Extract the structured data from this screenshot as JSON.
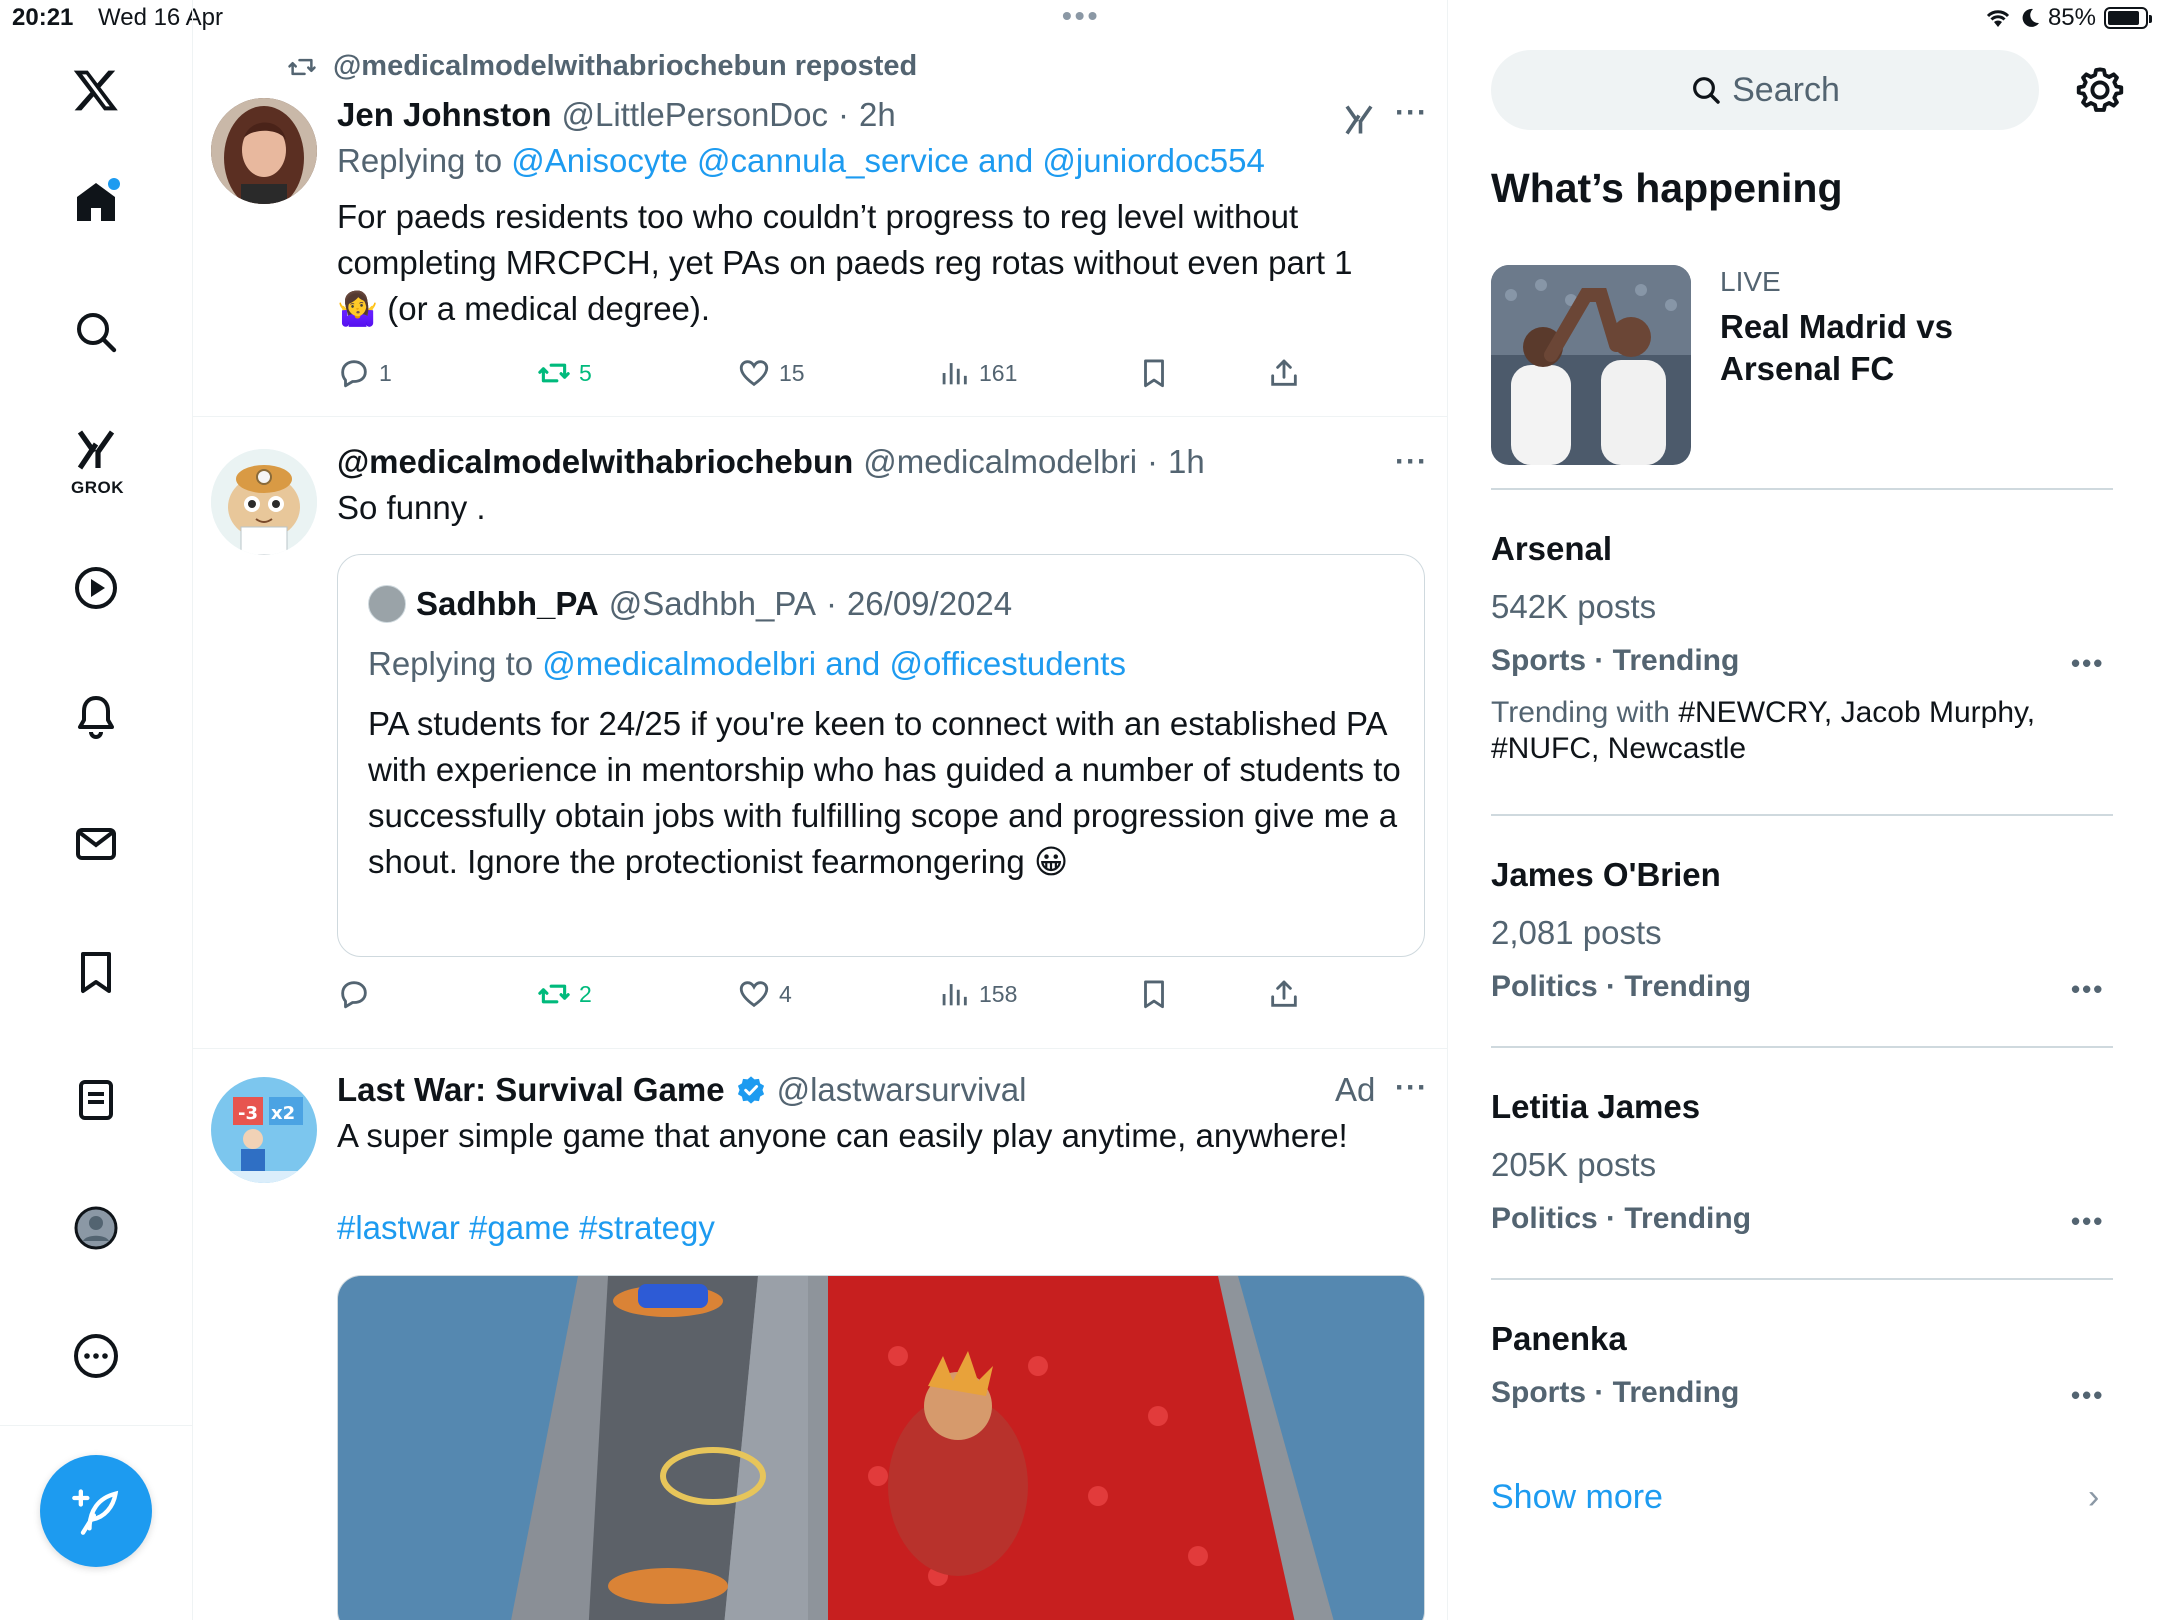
{
  "status_bar": {
    "time": "20:21",
    "date": "Wed 16 Apr",
    "battery_percent": "85%",
    "battery_level": 0.85
  },
  "nav": {
    "items": [
      {
        "name": "x-logo-icon"
      },
      {
        "name": "home-icon"
      },
      {
        "name": "search-icon"
      },
      {
        "name": "grok-icon",
        "label": "GROK"
      },
      {
        "name": "video-icon"
      },
      {
        "name": "notifications-icon"
      },
      {
        "name": "messages-icon"
      },
      {
        "name": "bookmarks-icon"
      },
      {
        "name": "lists-icon"
      },
      {
        "name": "profile-icon"
      },
      {
        "name": "more-icon"
      }
    ],
    "compose_icon": "compose-icon"
  },
  "tweets": [
    {
      "repost_label": "@medicalmodelwithabriochebun reposted",
      "name": "Jen Johnston",
      "handle": "@LittlePersonDoc",
      "time": "2h",
      "replying_prefix": "Replying to",
      "replying_to": "@Anisocyte @cannula_service and @juniordoc554",
      "text": "For paeds residents too who couldn’t progress to reg level without completing MRCPCH, yet PAs on paeds reg rotas without even part 1 🤷‍♀️ (or a medical degree).",
      "replies": "1",
      "reposts": "5",
      "likes": "15",
      "views": "161"
    },
    {
      "name": "@medicalmodelwithabriochebun",
      "handle": "@medicalmodelbri",
      "time": "1h",
      "text": "So funny .",
      "quote": {
        "name": "Sadhbh_PA",
        "handle": "@Sadhbh_PA",
        "date": "26/09/2024",
        "replying_prefix": "Replying to",
        "replying_to": "@medicalmodelbri and @officestudents",
        "text": "PA students for 24/25 if you're keen to connect with an established PA with experience in mentorship who has guided a number of students to successfully obtain jobs with fulfilling scope and progression give me a shout. Ignore the protectionist fearmongering 😀"
      },
      "replies": "",
      "reposts": "2",
      "likes": "4",
      "views": "158"
    },
    {
      "name": "Last War: Survival Game",
      "handle": "@lastwarsurvival",
      "ad_label": "Ad",
      "text": "A super simple game that anyone can easily play anytime, anywhere!",
      "hashtags": "#lastwar #game #strategy"
    }
  ],
  "sidebar": {
    "search_placeholder": "Search",
    "whats_happening": "What’s happening",
    "live": {
      "label": "LIVE",
      "title": "Real Madrid vs Arsenal FC"
    },
    "trends": [
      {
        "name": "Arsenal",
        "count": "542K posts",
        "category": "Sports · Trending",
        "with_prefix": "Trending with",
        "with": "#NEWCRY, Jacob Murphy, #NUFC, Newcastle"
      },
      {
        "name": "James O'Brien",
        "count": "2,081 posts",
        "category": "Politics · Trending"
      },
      {
        "name": "Letitia James",
        "count": "205K posts",
        "category": "Politics · Trending"
      },
      {
        "name": "Panenka",
        "category": "Sports · Trending"
      }
    ],
    "show_more": "Show more"
  },
  "colors": {
    "accent": "#1d9bf0",
    "repost_green": "#00ba7c",
    "muted_text": "#536471",
    "divider": "#eff3f4"
  }
}
